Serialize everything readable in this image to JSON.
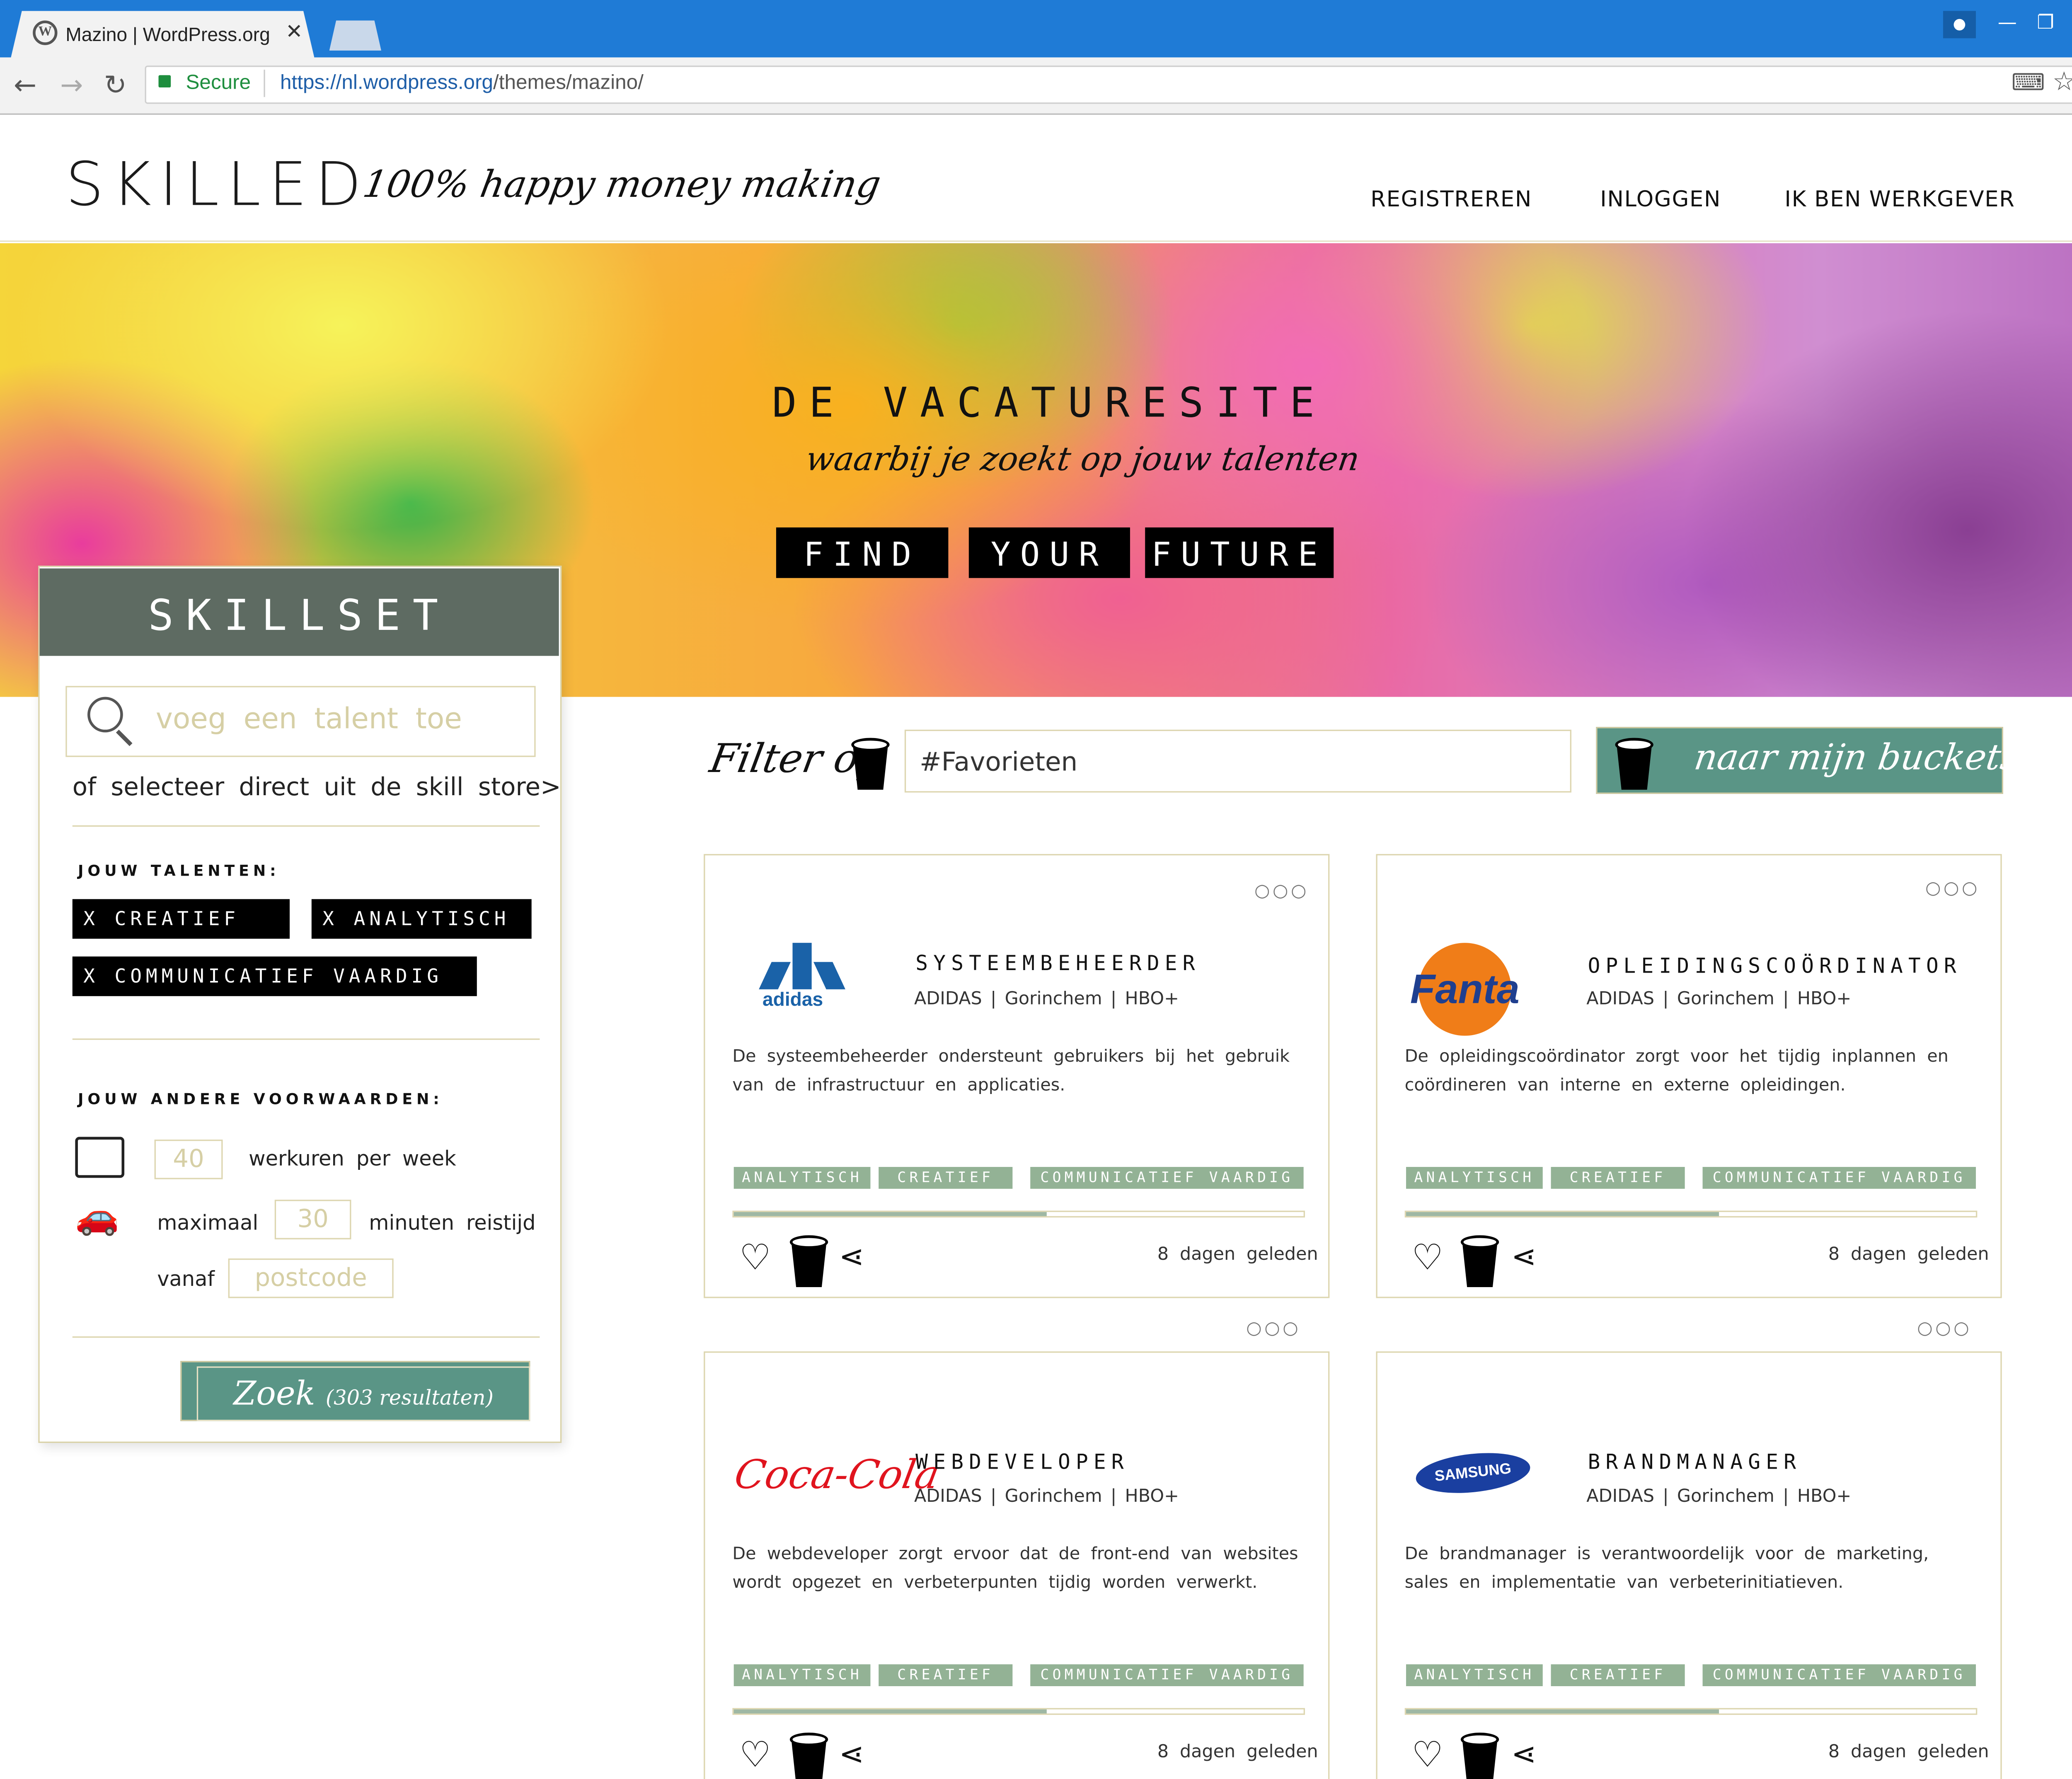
{
  "browser": {
    "tab_title": "Mazino | WordPress.org",
    "tab_close": "✕",
    "secure": "Secure",
    "url_host": "https://nl.wordpress.org",
    "url_path": "/themes/mazino/"
  },
  "header": {
    "logo": "SKILLED",
    "tagline": "100% happy money making",
    "nav": [
      "REGISTREREN",
      "INLOGGEN",
      "IK BEN WERKGEVER"
    ]
  },
  "hero": {
    "title": "DE VACATURESITE",
    "subtitle": "waarbij je zoekt op jouw talenten",
    "words": [
      "FIND",
      "YOUR",
      "FUTURE"
    ]
  },
  "skillset": {
    "title": "SKILLSET",
    "search_placeholder": "voeg een talent toe",
    "store_text": "of selecteer direct uit de skill store>",
    "talents_label": "JOUW TALENTEN:",
    "talents": [
      "X CREATIEF",
      "X ANALYTISCH",
      "X COMMUNICATIEF VAARDIG"
    ],
    "conditions_label": "JOUW ANDERE VOORWAARDEN:",
    "hours_value": "40",
    "hours_text": "werkuren per week",
    "max_text": "maximaal",
    "travel_value": "30",
    "travel_text": "minuten reistijd",
    "from_text": "vanaf",
    "postcode_placeholder": "postcode",
    "search_button": "Zoek",
    "results": "(303 resultaten)"
  },
  "filter": {
    "label": "Filter op",
    "value": "#Favorieten",
    "buckets_button": "naar mijn buckets >"
  },
  "jobs": [
    {
      "title": "SYSTEEMBEHEERDER",
      "meta": "ADIDAS | Gorinchem | HBO+",
      "description": "De systeembeheerder ondersteunt gebruikers bij het gebruik van de infrastructuur en applicaties.",
      "logo": "adidas",
      "tags": [
        "ANALYTISCH",
        "CREATIEF",
        "COMMUNICATIEF VAARDIG"
      ],
      "progress": 0.55,
      "posted": "8 dagen geleden",
      "menu": "○○○"
    },
    {
      "title": "OPLEIDINGSCOÖRDINATOR",
      "meta": "ADIDAS | Gorinchem | HBO+",
      "description": "De opleidingscoördinator zorgt voor het tijdig inplannen en coördineren van interne en externe opleidingen.",
      "logo": "Fanta",
      "tags": [
        "ANALYTISCH",
        "CREATIEF",
        "COMMUNICATIEF VAARDIG"
      ],
      "progress": 0.55,
      "posted": "8 dagen geleden",
      "menu": "○○○"
    },
    {
      "title": "WEBDEVELOPER",
      "meta": "ADIDAS | Gorinchem | HBO+",
      "description": "De webdeveloper zorgt ervoor dat de front-end van websites wordt opgezet en verbeterpunten tijdig worden verwerkt.",
      "logo": "Coca-Cola",
      "tags": [
        "ANALYTISCH",
        "CREATIEF",
        "COMMUNICATIEF VAARDIG"
      ],
      "progress": 0.55,
      "posted": "8 dagen geleden",
      "menu": "○○○"
    },
    {
      "title": "BRANDMANAGER",
      "meta": "ADIDAS | Gorinchem | HBO+",
      "description": "De brandmanager is verantwoordelijk voor de marketing, sales en implementatie van verbeterinitiatieven.",
      "logo": "SAMSUNG",
      "tags": [
        "ANALYTISCH",
        "CREATIEF",
        "COMMUNICATIEF VAARDIG"
      ],
      "progress": 0.55,
      "posted": "8 dagen geleden",
      "menu": "○○○"
    }
  ],
  "colors": {
    "accent": "#5a9586",
    "panel_head": "#5e6b62",
    "tag": "#93b295",
    "border": "#ddd6b0",
    "chrome_blue": "#1f7bd6"
  }
}
